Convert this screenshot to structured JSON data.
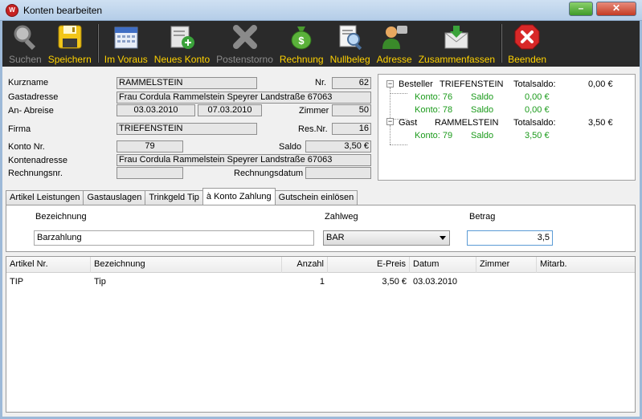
{
  "window": {
    "title": "Konten bearbeiten",
    "app_icon_text": "W"
  },
  "toolbar": [
    {
      "label": "Suchen",
      "icon": "magnifier-icon",
      "enabled": false
    },
    {
      "label": "Speichern",
      "icon": "floppy-disk-icon",
      "enabled": true
    },
    {
      "label": "Im Voraus",
      "icon": "calendar-icon",
      "enabled": true
    },
    {
      "label": "Neues Konto",
      "icon": "new-account-icon",
      "enabled": true
    },
    {
      "label": "Postenstorno",
      "icon": "cancel-x-icon",
      "enabled": false
    },
    {
      "label": "Rechnung",
      "icon": "money-bag-icon",
      "enabled": true
    },
    {
      "label": "Nullbeleg",
      "icon": "document-search-icon",
      "enabled": true
    },
    {
      "label": "Adresse",
      "icon": "person-icon",
      "enabled": true
    },
    {
      "label": "Zusammenfassen",
      "icon": "envelope-download-icon",
      "enabled": true
    },
    {
      "label": "Beenden",
      "icon": "exit-icon",
      "enabled": true
    }
  ],
  "form": {
    "kurzname_label": "Kurzname",
    "kurzname": "RAMMELSTEIN",
    "nr_label": "Nr.",
    "nr": "62",
    "gastadresse_label": "Gastadresse",
    "gastadresse": "Frau Cordula Rammelstein Speyrer Landstraße 67063",
    "an_abreise_label": "An- Abreise",
    "anreise": "03.03.2010",
    "abreise": "07.03.2010",
    "zimmer_label": "Zimmer",
    "zimmer": "50",
    "firma_label": "Firma",
    "firma": "TRIEFENSTEIN",
    "resnr_label": "Res.Nr.",
    "resnr": "16",
    "konto_nr_label": "Konto Nr.",
    "konto_nr": "79",
    "saldo_label": "Saldo",
    "saldo": "3,50 €",
    "kontenadresse_label": "Kontenadresse",
    "kontenadresse": "Frau Cordula Rammelstein Speyrer Landstraße 67063",
    "rechnungsnr_label": "Rechnungsnr.",
    "rechnungsnr": "",
    "rechnungsdatum_label": "Rechnungsdatum",
    "rechnungsdatum": ""
  },
  "tree": {
    "besteller": {
      "role": "Besteller",
      "name": "TRIEFENSTEIN",
      "total_label": "Totalsaldo:",
      "total": "0,00 €",
      "konten": [
        {
          "konto": "Konto: 76",
          "saldo_label": "Saldo",
          "saldo": "0,00 €"
        },
        {
          "konto": "Konto: 78",
          "saldo_label": "Saldo",
          "saldo": "0,00 €"
        }
      ]
    },
    "gast": {
      "role": "Gast",
      "name": "RAMMELSTEIN",
      "total_label": "Totalsaldo:",
      "total": "3,50 €",
      "konten": [
        {
          "konto": "Konto: 79",
          "saldo_label": "Saldo",
          "saldo": "3,50 €"
        }
      ]
    }
  },
  "tabs": [
    "Artikel Leistungen",
    "Gastauslagen",
    "Trinkgeld Tip",
    "à Konto Zahlung",
    "Gutschein einlösen"
  ],
  "active_tab": 3,
  "payment": {
    "bezeichnung_label": "Bezeichnung",
    "bezeichnung": "Barzahlung",
    "zahlweg_label": "Zahlweg",
    "zahlweg": "BAR",
    "betrag_label": "Betrag",
    "betrag": "3,5"
  },
  "grid": {
    "columns": [
      "Artikel Nr.",
      "Bezeichnung",
      "Anzahl",
      "E-Preis",
      "Datum",
      "Zimmer",
      "Mitarb."
    ],
    "rows": [
      [
        "TIP",
        "Tip",
        "1",
        "3,50 €",
        "03.03.2010",
        "",
        ""
      ]
    ]
  }
}
